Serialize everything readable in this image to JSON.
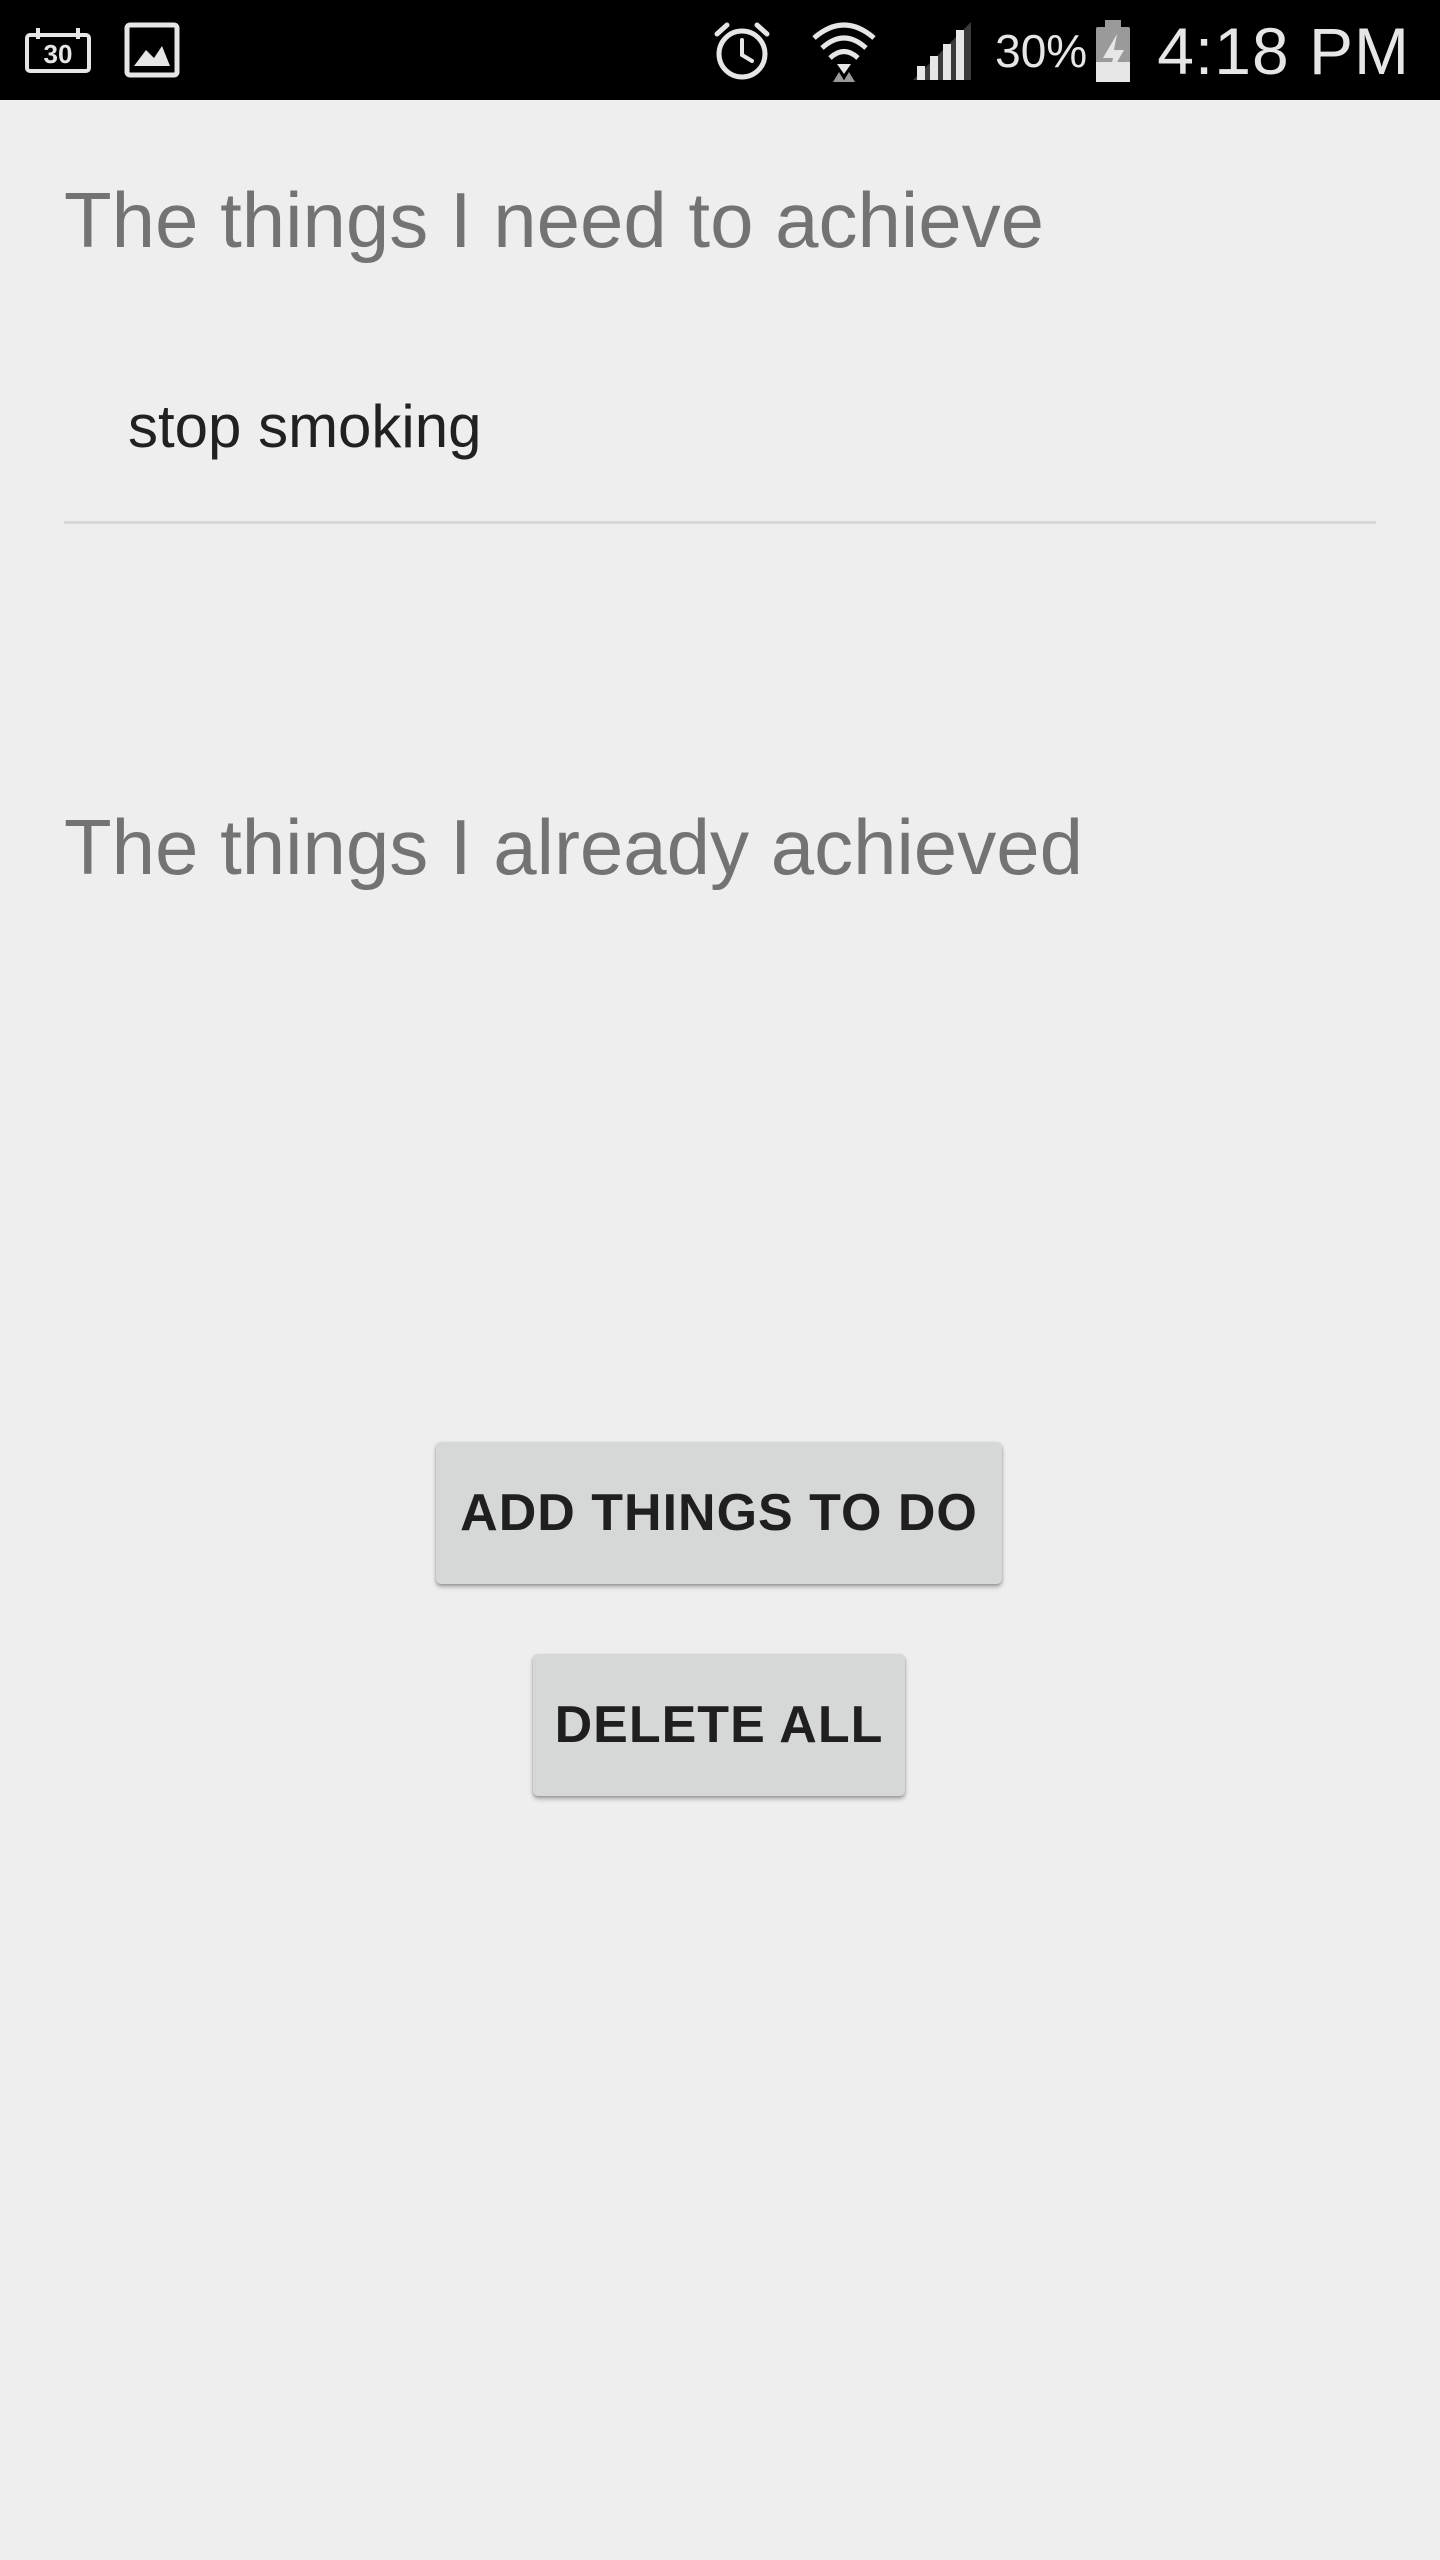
{
  "status_bar": {
    "notification_icons": [
      "thirty-day-calendar-icon",
      "image-icon"
    ],
    "system_icons": [
      "alarm-clock-icon",
      "wifi-icon",
      "cell-signal-icon",
      "battery-charging-icon"
    ],
    "battery_percent": "30%",
    "time": "4:18 PM"
  },
  "sections": {
    "to_achieve_title": "The things I need to achieve",
    "to_achieve_items": [
      "stop smoking"
    ],
    "achieved_title": "The things I already achieved",
    "achieved_items": []
  },
  "buttons": {
    "add_label": "ADD THINGS TO DO",
    "delete_label": "DELETE ALL"
  },
  "colors": {
    "background": "#eeeeee",
    "status_bar": "#000000",
    "section_title": "#737373",
    "item_text": "#212121",
    "button_bg": "#d6d7d7",
    "divider": "#d7d7d7"
  }
}
